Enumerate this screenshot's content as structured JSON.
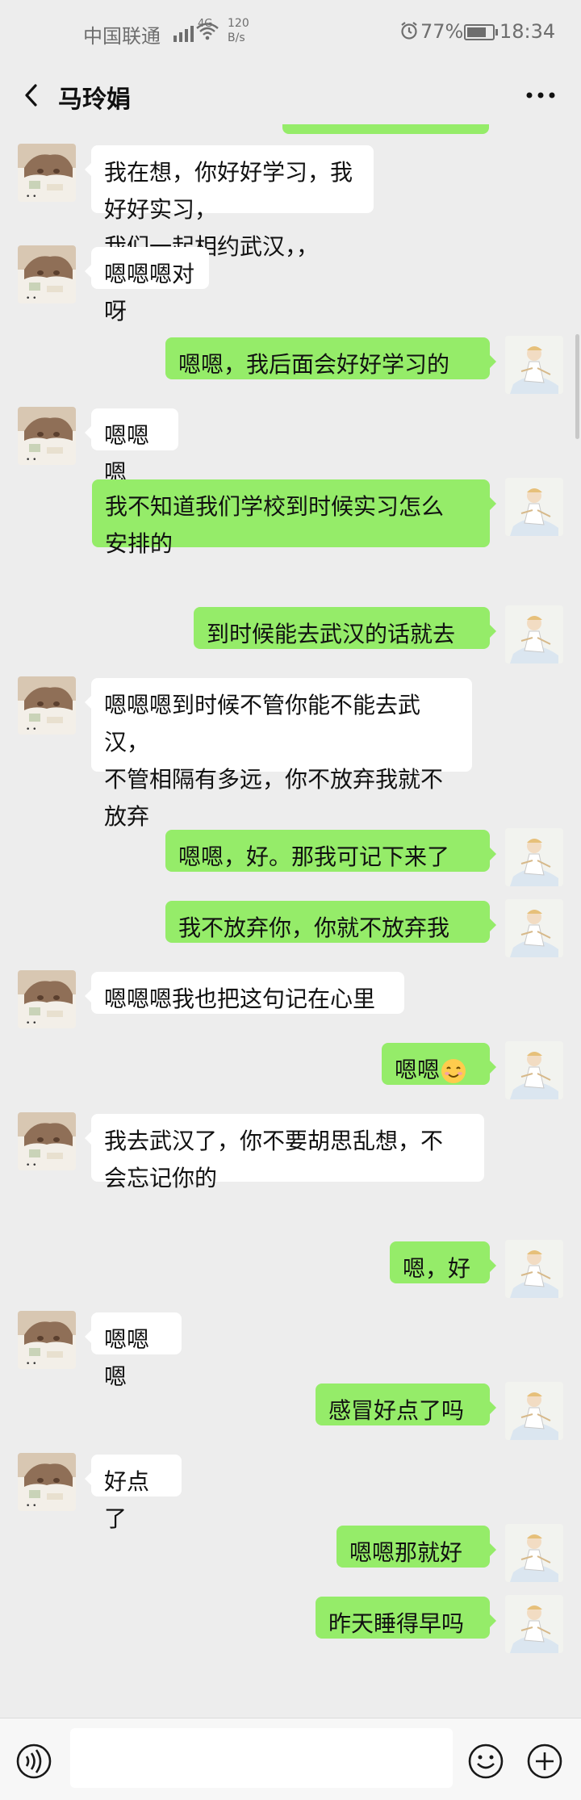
{
  "status_bar": {
    "carrier": "中国联通",
    "network": "4G",
    "speed_value": "120",
    "speed_unit": "B/s",
    "battery": "77%",
    "battery_level": 0.77,
    "time": "18:34"
  },
  "header": {
    "title": "马玲娟"
  },
  "messages": [
    {
      "side": "in",
      "text": "我在想，你好好学习，我好好实习，\n我们一起相约武汉，，"
    },
    {
      "side": "in",
      "text": "嗯嗯嗯对呀"
    },
    {
      "side": "out",
      "text": "嗯嗯，我后面会好好学习的"
    },
    {
      "side": "in",
      "text": "嗯嗯嗯"
    },
    {
      "side": "out",
      "text": "我不知道我们学校到时候实习怎么\n安排的"
    },
    {
      "side": "out",
      "text": "到时候能去武汉的话就去"
    },
    {
      "side": "in",
      "text": "嗯嗯嗯到时候不管你能不能去武汉，\n不管相隔有多远，你不放弃我就不\n放弃"
    },
    {
      "side": "out",
      "text": "嗯嗯，好。那我可记下来了"
    },
    {
      "side": "out",
      "text": "我不放弃你，你就不放弃我"
    },
    {
      "side": "in",
      "text": "嗯嗯嗯我也把这句记在心里"
    },
    {
      "side": "out",
      "text": "嗯嗯",
      "emoji": "smile-emoji"
    },
    {
      "side": "in",
      "text": "我去武汉了，你不要胡思乱想，不\n会忘记你的"
    },
    {
      "side": "out",
      "text": "嗯，好"
    },
    {
      "side": "in",
      "text": "嗯嗯嗯"
    },
    {
      "side": "out",
      "text": "感冒好点了吗"
    },
    {
      "side": "in",
      "text": "好点了"
    },
    {
      "side": "out",
      "text": "嗯嗯那就好"
    },
    {
      "side": "out",
      "text": "昨天睡得早吗"
    }
  ],
  "input_bar": {
    "draft": "",
    "icons": [
      "voice-icon",
      "emoji-icon",
      "plus-icon"
    ]
  },
  "colors": {
    "background": "#ededed",
    "outgoing_bubble": "#95ec69",
    "incoming_bubble": "#ffffff"
  }
}
